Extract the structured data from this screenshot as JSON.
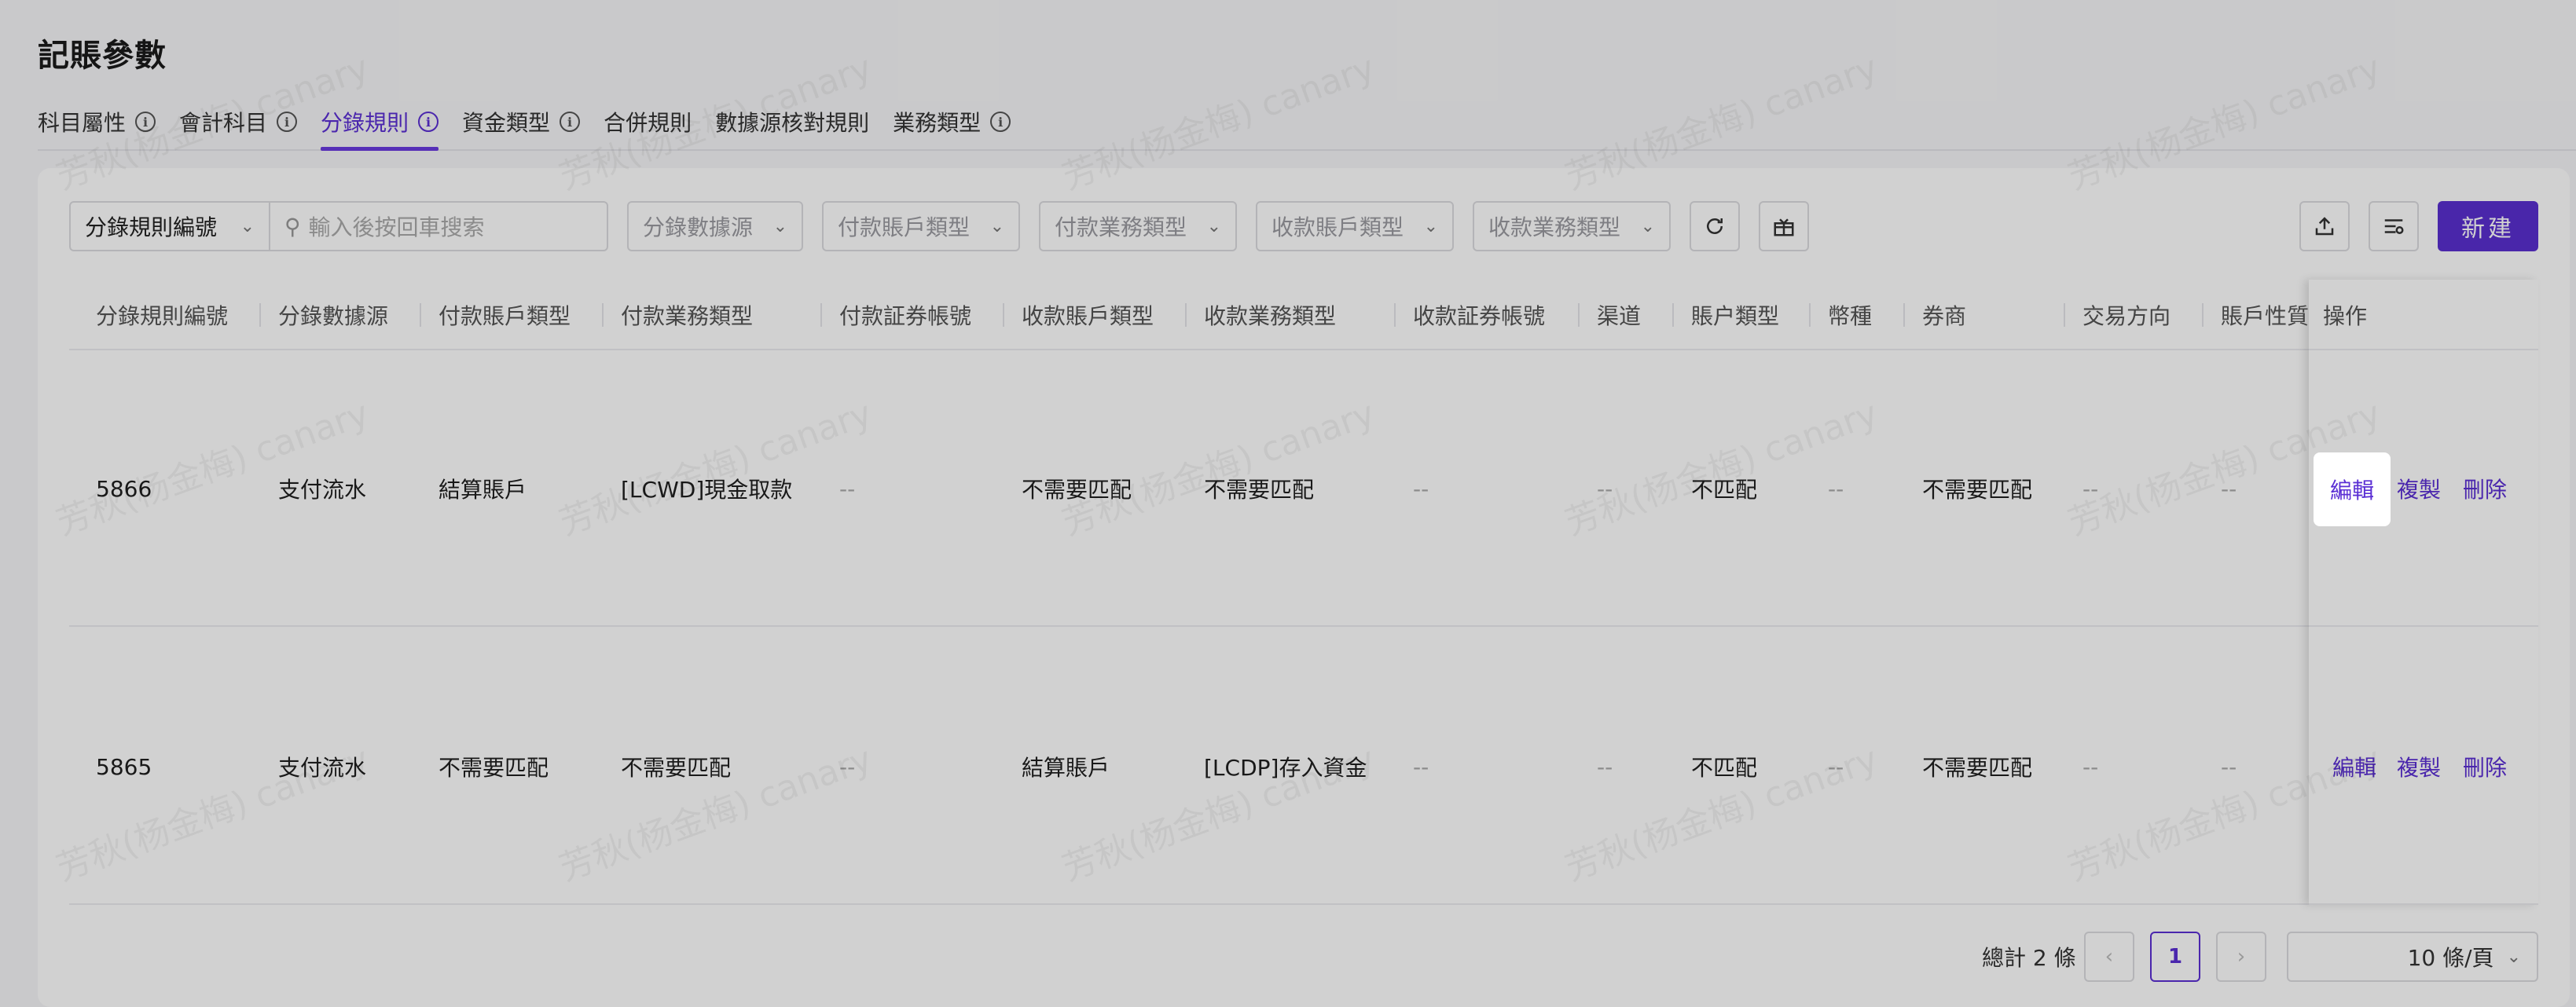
{
  "page": {
    "title": "記賬參數"
  },
  "tabs": [
    {
      "label": "科目屬性",
      "info": true,
      "active": false
    },
    {
      "label": "會計科目",
      "info": true,
      "active": false
    },
    {
      "label": "分錄規則",
      "info": true,
      "active": true
    },
    {
      "label": "資金類型",
      "info": true,
      "active": false
    },
    {
      "label": "合併規則",
      "info": false,
      "active": false
    },
    {
      "label": "數據源核對規則",
      "info": false,
      "active": false
    },
    {
      "label": "業務類型",
      "info": true,
      "active": false
    }
  ],
  "toolbar": {
    "field_select": "分錄規則編號",
    "search_placeholder": "輸入後按回車搜索",
    "filters": [
      "分錄數據源",
      "付款賬戶類型",
      "付款業務類型",
      "收款賬戶類型",
      "收款業務類型"
    ],
    "new_label": "新建"
  },
  "table": {
    "columns": [
      "分錄規則編號",
      "分錄數據源",
      "付款賬戶類型",
      "付款業務類型",
      "付款証券帳號",
      "收款賬戶類型",
      "收款業務類型",
      "收款証券帳號",
      "渠道",
      "賬户類型",
      "幣種",
      "券商",
      "交易方向",
      "賬戶性質",
      "操作"
    ],
    "rows": [
      [
        "5866",
        "支付流水",
        "結算賬戶",
        "[LCWD]現金取款",
        "--",
        "不需要匹配",
        "不需要匹配",
        "--",
        "--",
        "不匹配",
        "--",
        "不需要匹配",
        "--",
        "--"
      ],
      [
        "5865",
        "支付流水",
        "不需要匹配",
        "不需要匹配",
        "--",
        "結算賬戶",
        "[LCDP]存入資金",
        "--",
        "--",
        "不匹配",
        "--",
        "不需要匹配",
        "--",
        "--"
      ]
    ],
    "actions": {
      "edit": "編輯",
      "copy": "複製",
      "delete": "刪除"
    }
  },
  "pagination": {
    "total": "總計 2 條",
    "current": "1",
    "page_size": "10 條/頁"
  },
  "watermark": "芳秋(杨金梅) canary"
}
